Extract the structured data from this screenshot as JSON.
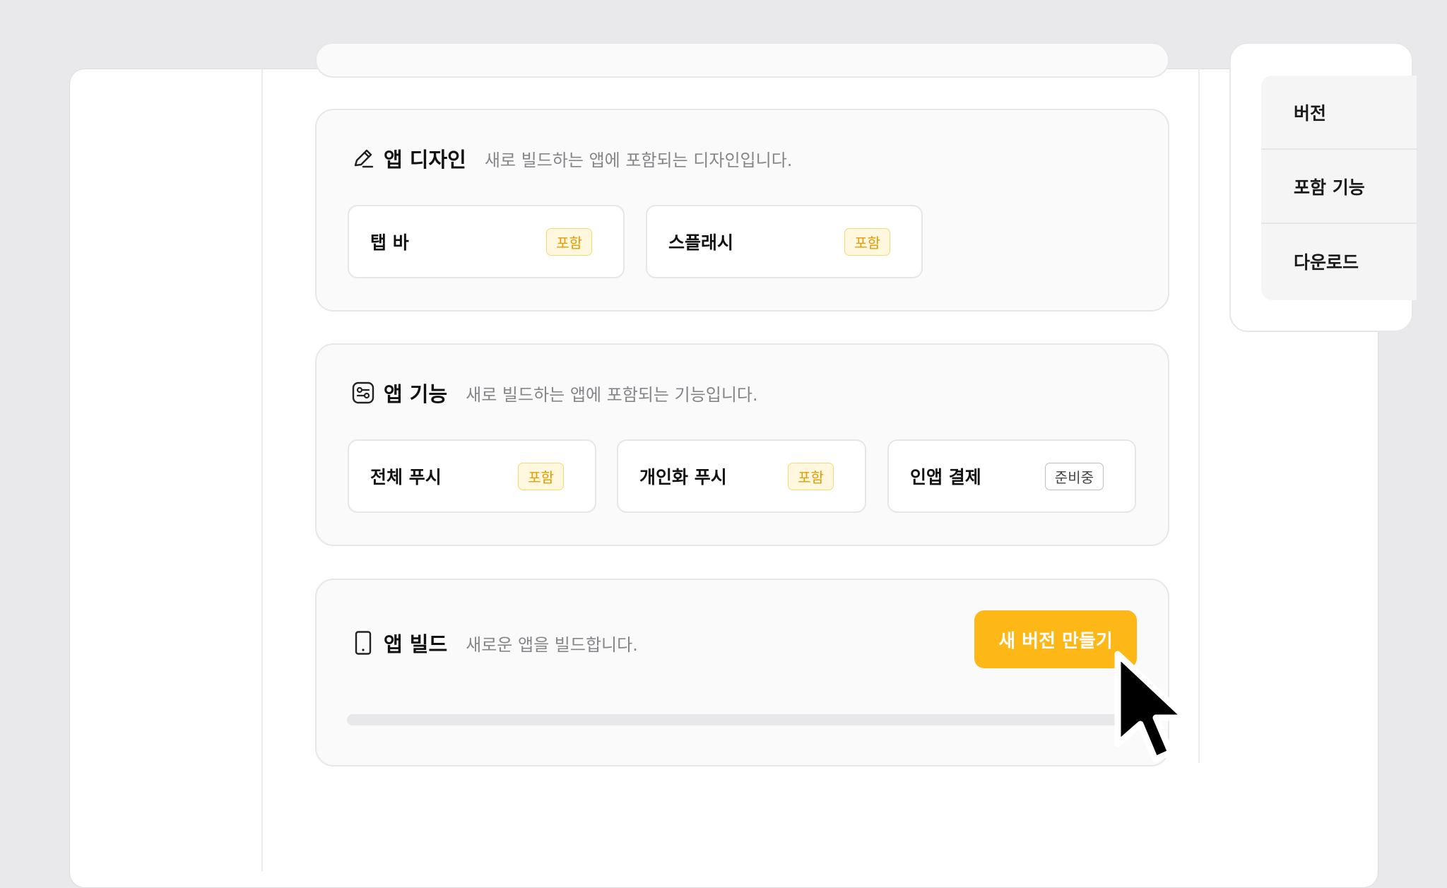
{
  "sections": {
    "design": {
      "title": "앱 디자인",
      "desc": "새로 빌드하는 앱에 포함되는 디자인입니다.",
      "icon": "pencil-icon",
      "items": [
        {
          "name": "탭 바",
          "status": "포함"
        },
        {
          "name": "스플래시",
          "status": "포함"
        }
      ]
    },
    "features": {
      "title": "앱 기능",
      "desc": "새로 빌드하는 앱에 포함되는 기능입니다.",
      "icon": "toggles-icon",
      "items": [
        {
          "name": "전체 푸시",
          "status": "포함"
        },
        {
          "name": "개인화 푸시",
          "status": "포함"
        },
        {
          "name": "인앱 결제",
          "status": "준비중"
        }
      ]
    },
    "build": {
      "title": "앱 빌드",
      "desc": "새로운 앱을 빌드합니다.",
      "icon": "phone-icon",
      "cta_label": "새 버전 만들기",
      "progress_fraction": 0
    }
  },
  "side_nav": {
    "items": [
      "버전",
      "포함 기능",
      "다운로드"
    ]
  },
  "colors": {
    "accent": "#fdb716",
    "badge_included_text": "#e59a00",
    "badge_included_bg": "#fff8df"
  }
}
